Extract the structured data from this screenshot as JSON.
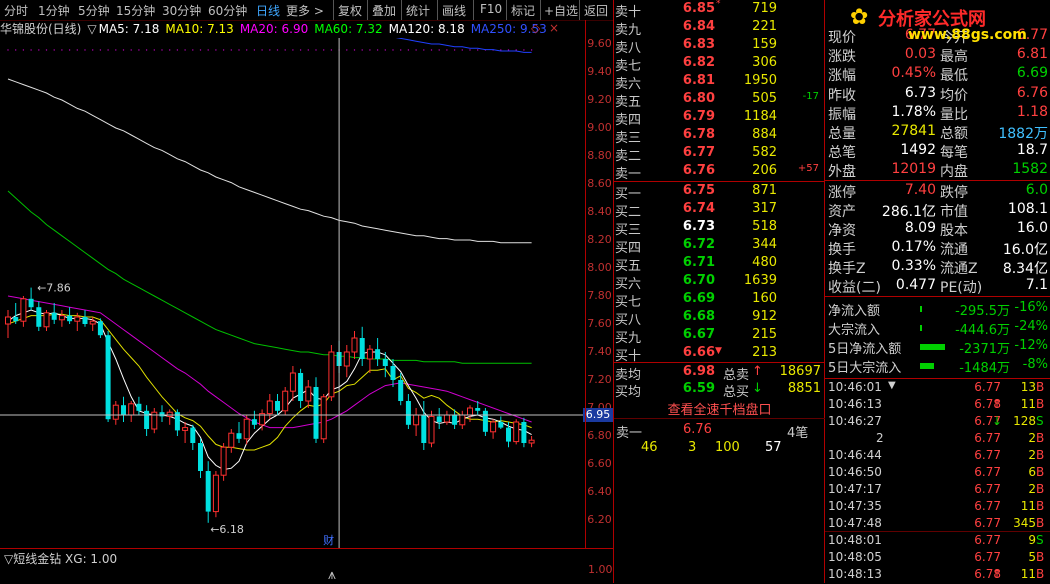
{
  "toolbar": {
    "tabs": [
      "分时",
      "1分钟",
      "5分钟",
      "15分钟",
      "30分钟",
      "60分钟",
      "日线",
      "更多 >"
    ],
    "active_tab": "日线",
    "buttons": [
      "复权",
      "叠加",
      "统计",
      "画线",
      "F10",
      "标记",
      "+自选",
      "返回"
    ]
  },
  "chart_title": {
    "stock": "华锦股份(日线)",
    "ma5": "MA5: 7.18",
    "ma10": "MA10: 7.13",
    "ma20": "MA20: 6.90",
    "ma60": "MA60: 7.32",
    "ma120": "MA120: 8.18",
    "ma250": "MA250: 9.53",
    "colors": {
      "ma5": "#ffffff",
      "ma10": "#ffff00",
      "ma20": "#ff00ff",
      "ma60": "#00ff00",
      "ma120": "#ffffff",
      "ma250": "#3050ff"
    }
  },
  "chart_data": {
    "type": "candlestick",
    "ylim": [
      6.0,
      9.8
    ],
    "yticks": [
      "9.60",
      "9.40",
      "9.20",
      "9.00",
      "8.80",
      "8.60",
      "8.40",
      "8.20",
      "8.00",
      "7.80",
      "7.60",
      "7.40",
      "7.20",
      "7.00",
      "6.80",
      "6.60",
      "6.40",
      "6.20"
    ],
    "cursor_price": "6.95",
    "high_label": "7.86",
    "low_label": "6.18",
    "marker": "财",
    "candles": [
      [
        7.6,
        7.7,
        7.5,
        7.65
      ],
      [
        7.65,
        7.75,
        7.6,
        7.62
      ],
      [
        7.62,
        7.8,
        7.58,
        7.78
      ],
      [
        7.78,
        7.86,
        7.7,
        7.72
      ],
      [
        7.72,
        7.76,
        7.55,
        7.58
      ],
      [
        7.58,
        7.7,
        7.55,
        7.68
      ],
      [
        7.68,
        7.75,
        7.6,
        7.63
      ],
      [
        7.63,
        7.7,
        7.58,
        7.66
      ],
      [
        7.66,
        7.72,
        7.6,
        7.62
      ],
      [
        7.62,
        7.68,
        7.55,
        7.65
      ],
      [
        7.65,
        7.7,
        7.58,
        7.6
      ],
      [
        7.6,
        7.65,
        7.55,
        7.62
      ],
      [
        7.62,
        7.64,
        7.5,
        7.52
      ],
      [
        7.52,
        7.55,
        6.9,
        6.92
      ],
      [
        6.92,
        7.05,
        6.88,
        7.02
      ],
      [
        7.02,
        7.08,
        6.9,
        6.95
      ],
      [
        6.95,
        7.05,
        6.9,
        7.03
      ],
      [
        7.03,
        7.08,
        6.95,
        6.98
      ],
      [
        6.98,
        7.02,
        6.8,
        6.85
      ],
      [
        6.85,
        7.0,
        6.82,
        6.97
      ],
      [
        6.97,
        7.02,
        6.9,
        6.94
      ],
      [
        6.94,
        6.99,
        6.88,
        6.97
      ],
      [
        6.97,
        6.99,
        6.8,
        6.84
      ],
      [
        6.84,
        6.9,
        6.75,
        6.86
      ],
      [
        6.86,
        6.88,
        6.7,
        6.75
      ],
      [
        6.75,
        6.78,
        6.5,
        6.55
      ],
      [
        6.55,
        6.62,
        6.18,
        6.26
      ],
      [
        6.26,
        6.55,
        6.22,
        6.52
      ],
      [
        6.52,
        6.75,
        6.48,
        6.72
      ],
      [
        6.72,
        6.85,
        6.68,
        6.82
      ],
      [
        6.82,
        6.9,
        6.75,
        6.78
      ],
      [
        6.78,
        6.95,
        6.74,
        6.92
      ],
      [
        6.92,
        6.98,
        6.85,
        6.88
      ],
      [
        6.88,
        6.99,
        6.84,
        6.96
      ],
      [
        6.96,
        7.1,
        6.92,
        7.05
      ],
      [
        7.05,
        7.1,
        6.95,
        6.98
      ],
      [
        6.98,
        7.15,
        6.95,
        7.12
      ],
      [
        7.12,
        7.3,
        7.05,
        7.25
      ],
      [
        7.25,
        7.28,
        7.0,
        7.05
      ],
      [
        7.05,
        7.2,
        7.0,
        7.15
      ],
      [
        7.15,
        7.22,
        6.75,
        6.78
      ],
      [
        6.78,
        7.1,
        6.75,
        7.08
      ],
      [
        7.08,
        7.45,
        7.05,
        7.4
      ],
      [
        7.4,
        7.48,
        7.25,
        7.3
      ],
      [
        7.3,
        7.45,
        7.22,
        7.4
      ],
      [
        7.4,
        7.55,
        7.35,
        7.5
      ],
      [
        7.5,
        7.58,
        7.3,
        7.35
      ],
      [
        7.35,
        7.45,
        7.25,
        7.42
      ],
      [
        7.42,
        7.5,
        7.3,
        7.35
      ],
      [
        7.35,
        7.4,
        7.22,
        7.3
      ],
      [
        7.3,
        7.35,
        7.15,
        7.2
      ],
      [
        7.2,
        7.25,
        7.02,
        7.05
      ],
      [
        7.05,
        7.1,
        6.85,
        6.88
      ],
      [
        6.88,
        7.0,
        6.8,
        6.95
      ],
      [
        6.95,
        7.05,
        6.7,
        6.75
      ],
      [
        6.75,
        6.98,
        6.72,
        6.94
      ],
      [
        6.94,
        7.0,
        6.85,
        6.9
      ],
      [
        6.9,
        6.98,
        6.88,
        6.95
      ],
      [
        6.95,
        6.99,
        6.85,
        6.88
      ],
      [
        6.88,
        6.98,
        6.85,
        6.95
      ],
      [
        6.95,
        7.02,
        6.9,
        7.0
      ],
      [
        7.0,
        7.05,
        6.95,
        6.98
      ],
      [
        6.98,
        7.0,
        6.8,
        6.83
      ],
      [
        6.83,
        6.92,
        6.78,
        6.9
      ],
      [
        6.9,
        6.94,
        6.85,
        6.86
      ],
      [
        6.86,
        6.9,
        6.72,
        6.76
      ],
      [
        6.76,
        6.92,
        6.74,
        6.9
      ],
      [
        6.9,
        6.93,
        6.72,
        6.75
      ],
      [
        6.75,
        6.8,
        6.72,
        6.77
      ]
    ],
    "ma5": [
      7.62,
      7.66,
      7.68,
      7.7,
      7.68,
      7.67,
      7.68,
      7.66,
      7.64,
      7.64,
      7.64,
      7.63,
      7.6,
      7.47,
      7.35,
      7.21,
      7.08,
      6.98,
      6.96,
      6.95,
      6.95,
      6.94,
      6.92,
      6.89,
      6.87,
      6.79,
      6.65,
      6.59,
      6.56,
      6.57,
      6.62,
      6.75,
      6.82,
      6.87,
      6.92,
      6.95,
      7.0,
      7.07,
      7.1,
      7.13,
      7.07,
      7.06,
      7.13,
      7.15,
      7.19,
      7.28,
      7.39,
      7.4,
      7.4,
      7.38,
      7.32,
      7.26,
      7.16,
      7.07,
      6.97,
      6.91,
      6.89,
      6.9,
      6.89,
      6.92,
      6.94,
      6.95,
      6.93,
      6.92,
      6.9,
      6.87,
      6.85,
      6.84,
      6.81
    ],
    "ma10": [
      7.6,
      7.62,
      7.64,
      7.66,
      7.66,
      7.66,
      7.67,
      7.67,
      7.66,
      7.66,
      7.65,
      7.65,
      7.63,
      7.56,
      7.49,
      7.42,
      7.36,
      7.3,
      7.22,
      7.15,
      7.08,
      7.02,
      6.96,
      6.93,
      6.91,
      6.87,
      6.8,
      6.74,
      6.72,
      6.72,
      6.71,
      6.7,
      6.7,
      6.72,
      6.74,
      6.79,
      6.87,
      6.93,
      6.98,
      7.02,
      7.01,
      7.03,
      7.1,
      7.12,
      7.16,
      7.17,
      7.22,
      7.27,
      7.27,
      7.28,
      7.2,
      7.23,
      7.14,
      7.11,
      7.07,
      7.09,
      7.07,
      7.02,
      6.98,
      6.94,
      6.92,
      6.92,
      6.91,
      6.9,
      6.91,
      6.9,
      6.89,
      6.88,
      6.86
    ],
    "ma20": [
      7.8,
      7.79,
      7.78,
      7.77,
      7.76,
      7.75,
      7.74,
      7.73,
      7.72,
      7.71,
      7.7,
      7.69,
      7.68,
      7.64,
      7.6,
      7.56,
      7.52,
      7.48,
      7.44,
      7.4,
      7.36,
      7.32,
      7.28,
      7.25,
      7.21,
      7.17,
      7.12,
      7.08,
      7.04,
      7.0,
      6.96,
      6.93,
      6.9,
      6.88,
      6.86,
      6.86,
      6.86,
      6.86,
      6.87,
      6.88,
      6.89,
      6.9,
      6.92,
      6.95,
      6.98,
      7.02,
      7.06,
      7.1,
      7.13,
      7.16,
      7.17,
      7.18,
      7.17,
      7.16,
      7.15,
      7.14,
      7.13,
      7.12,
      7.1,
      7.08,
      7.06,
      7.04,
      7.02,
      7.0,
      6.98,
      6.96,
      6.94,
      6.92,
      6.9
    ],
    "ma60": [
      8.55,
      8.5,
      8.45,
      8.4,
      8.36,
      8.31,
      8.27,
      8.23,
      8.19,
      8.15,
      8.11,
      8.07,
      8.03,
      7.99,
      7.96,
      7.92,
      7.89,
      7.86,
      7.83,
      7.8,
      7.77,
      7.74,
      7.71,
      7.68,
      7.65,
      7.62,
      7.59,
      7.56,
      7.54,
      7.52,
      7.5,
      7.48,
      7.46,
      7.45,
      7.44,
      7.43,
      7.42,
      7.41,
      7.4,
      7.4,
      7.39,
      7.38,
      7.38,
      7.37,
      7.37,
      7.36,
      7.36,
      7.35,
      7.35,
      7.35,
      7.34,
      7.34,
      7.34,
      7.34,
      7.33,
      7.33,
      7.33,
      7.33,
      7.33,
      7.32,
      7.32,
      7.32,
      7.32,
      7.32,
      7.32,
      7.32,
      7.32,
      7.32,
      7.32
    ],
    "ma120": [
      9.35,
      9.33,
      9.31,
      9.29,
      9.27,
      9.25,
      9.22,
      9.2,
      9.17,
      9.14,
      9.12,
      9.09,
      9.06,
      9.03,
      9.0,
      8.98,
      8.95,
      8.92,
      8.89,
      8.86,
      8.84,
      8.81,
      8.78,
      8.76,
      8.73,
      8.7,
      8.68,
      8.65,
      8.63,
      8.61,
      8.58,
      8.56,
      8.54,
      8.52,
      8.5,
      8.48,
      8.46,
      8.44,
      8.42,
      8.41,
      8.39,
      8.37,
      8.36,
      8.34,
      8.33,
      8.32,
      8.3,
      8.29,
      8.28,
      8.27,
      8.26,
      8.25,
      8.24,
      8.23,
      8.23,
      8.22,
      8.21,
      8.21,
      8.2,
      8.2,
      8.2,
      8.19,
      8.19,
      8.19,
      8.18,
      8.18,
      8.18,
      8.18,
      8.18
    ],
    "ma250_start": 44,
    "ma250": [
      9.71,
      9.7,
      9.69,
      9.68,
      9.67,
      9.66,
      9.65,
      9.64,
      9.63,
      9.62,
      9.61,
      9.6,
      9.6,
      9.59,
      9.58,
      9.58,
      9.57,
      9.57,
      9.56,
      9.56,
      9.55,
      9.55,
      9.55,
      9.54,
      9.54
    ]
  },
  "indicator": {
    "label": "▽短线金钻 XG: 1.00",
    "axis_value": "1.00"
  },
  "order_book": {
    "sell": [
      {
        "label": "卖十",
        "price": "6.85",
        "vol": "719",
        "chg": "",
        "mark": "*"
      },
      {
        "label": "卖九",
        "price": "6.84",
        "vol": "221",
        "chg": ""
      },
      {
        "label": "卖八",
        "price": "6.83",
        "vol": "159",
        "chg": ""
      },
      {
        "label": "卖七",
        "price": "6.82",
        "vol": "306",
        "chg": ""
      },
      {
        "label": "卖六",
        "price": "6.81",
        "vol": "1950",
        "chg": ""
      },
      {
        "label": "卖五",
        "price": "6.80",
        "vol": "505",
        "chg": "-17"
      },
      {
        "label": "卖四",
        "price": "6.79",
        "vol": "1184",
        "chg": ""
      },
      {
        "label": "卖三",
        "price": "6.78",
        "vol": "884",
        "chg": ""
      },
      {
        "label": "卖二",
        "price": "6.77",
        "vol": "582",
        "chg": ""
      },
      {
        "label": "卖一",
        "price": "6.76",
        "vol": "206",
        "chg": "+57"
      }
    ],
    "buy": [
      {
        "label": "买一",
        "price": "6.75",
        "vol": "871",
        "color": "red"
      },
      {
        "label": "买二",
        "price": "6.74",
        "vol": "317",
        "color": "red"
      },
      {
        "label": "买三",
        "price": "6.73",
        "vol": "518",
        "color": "white"
      },
      {
        "label": "买四",
        "price": "6.72",
        "vol": "344",
        "color": "green"
      },
      {
        "label": "买五",
        "price": "6.71",
        "vol": "480",
        "color": "green"
      },
      {
        "label": "买六",
        "price": "6.70",
        "vol": "1639",
        "color": "green"
      },
      {
        "label": "买七",
        "price": "6.69",
        "vol": "160",
        "color": "green"
      },
      {
        "label": "买八",
        "price": "6.68",
        "vol": "912",
        "color": "green"
      },
      {
        "label": "买九",
        "price": "6.67",
        "vol": "215",
        "color": "green"
      },
      {
        "label": "买十",
        "price": "6.66",
        "vol": "213",
        "color": "red",
        "mark": "▼"
      }
    ],
    "avg_sell": {
      "label": "卖均",
      "price": "6.98",
      "tlabel": "总卖",
      "arrow": "↑",
      "total": "18697"
    },
    "avg_buy": {
      "label": "买均",
      "price": "6.59",
      "tlabel": "总买",
      "arrow": "↓",
      "total": "8851"
    },
    "full_depth_button": "查看全速千档盘口",
    "sell1_detail": {
      "label": "卖一",
      "price": "6.76",
      "count": "4笔",
      "orders": [
        "46",
        "3",
        "100",
        "57"
      ]
    }
  },
  "stats": {
    "logo_text": "分析家公式网",
    "logo_url": "www.88gs.com",
    "rows": [
      {
        "k1": "现价",
        "v1": "6.77",
        "c1": "red",
        "k2": "今开",
        "v2": "6.77",
        "c2": "red"
      },
      {
        "k1": "涨跌",
        "v1": "0.03",
        "c1": "red",
        "k2": "最高",
        "v2": "6.81",
        "c2": "red"
      },
      {
        "k1": "涨幅",
        "v1": "0.45%",
        "c1": "red",
        "k2": "最低",
        "v2": "6.69",
        "c2": "green"
      },
      {
        "k1": "昨收",
        "v1": "6.73",
        "c1": "white",
        "k2": "均价",
        "v2": "6.76",
        "c2": "red"
      },
      {
        "k1": "振幅",
        "v1": "1.78%",
        "c1": "white",
        "k2": "量比",
        "v2": "1.18",
        "c2": "red"
      },
      {
        "k1": "总量",
        "v1": "27841",
        "c1": "yellow",
        "k2": "总额",
        "v2": "1882万",
        "c2": "cyan"
      },
      {
        "k1": "总笔",
        "v1": "1492",
        "c1": "white",
        "k2": "每笔",
        "v2": "18.7",
        "c2": "white"
      },
      {
        "k1": "外盘",
        "v1": "12019",
        "c1": "red",
        "k2": "内盘",
        "v2": "1582",
        "c2": "green"
      }
    ],
    "rows2": [
      {
        "k1": "涨停",
        "v1": "7.40",
        "c1": "red",
        "k2": "跌停",
        "v2": "6.0",
        "c2": "green"
      },
      {
        "k1": "资产",
        "v1": "286.1亿",
        "c1": "white",
        "k2": "市值",
        "v2": "108.1",
        "c2": "white"
      },
      {
        "k1": "净资",
        "v1": "8.09",
        "c1": "white",
        "k2": "股本",
        "v2": "16.0",
        "c2": "white"
      },
      {
        "k1": "换手",
        "v1": "0.17%",
        "c1": "white",
        "k2": "流通",
        "v2": "16.0亿",
        "c2": "white"
      },
      {
        "k1": "换手Z",
        "v1": "0.33%",
        "c1": "white",
        "k2": "流通Z",
        "v2": "8.34亿",
        "c2": "white"
      },
      {
        "k1": "收益(二)",
        "v1": "0.477",
        "c1": "white",
        "k2": "PE(动)",
        "v2": "7.1",
        "c2": "white"
      }
    ],
    "flows": [
      {
        "label": "净流入额",
        "amount": "-295.5万",
        "pct": "-16%",
        "bar": 0.03
      },
      {
        "label": "大宗流入",
        "amount": "-444.6万",
        "pct": "-24%",
        "bar": 0.04
      },
      {
        "label": "5日净流入额",
        "amount": "-2371万",
        "pct": "-12%",
        "bar": 0.95
      },
      {
        "label": "5日大宗流入",
        "amount": "-1484万",
        "pct": "-8%",
        "bar": 0.55
      }
    ],
    "ticks": [
      {
        "t": "10:46:01",
        "mark": "▼",
        "p": "6.77",
        "a": "",
        "v": "13",
        "bs": "B",
        "bc": "red"
      },
      {
        "t": "10:46:13",
        "p": "6.78",
        "a": "↑",
        "v": "11",
        "bs": "B",
        "bc": "red"
      },
      {
        "t": "10:46:27",
        "p": "6.77",
        "a": "↓",
        "v": "128",
        "bs": "S",
        "bc": "green"
      },
      {
        "t": "2",
        "p": "6.77",
        "a": "",
        "v": "2",
        "bs": "B",
        "bc": "red"
      },
      {
        "t": "10:46:44",
        "p": "6.77",
        "a": "",
        "v": "2",
        "bs": "B",
        "bc": "red"
      },
      {
        "t": "10:46:50",
        "p": "6.77",
        "a": "",
        "v": "6",
        "bs": "B",
        "bc": "red"
      },
      {
        "t": "10:47:17",
        "p": "6.77",
        "a": "",
        "v": "2",
        "bs": "B",
        "bc": "red"
      },
      {
        "t": "10:47:35",
        "p": "6.77",
        "a": "",
        "v": "11",
        "bs": "B",
        "bc": "red"
      },
      {
        "t": "10:47:48",
        "p": "6.77",
        "a": "",
        "v": "345",
        "bs": "B",
        "bc": "red"
      },
      {
        "t": "10:48:01",
        "p": "6.77",
        "a": "",
        "v": "9",
        "bs": "S",
        "bc": "green"
      },
      {
        "t": "10:48:05",
        "p": "6.77",
        "a": "",
        "v": "5",
        "bs": "B",
        "bc": "red"
      },
      {
        "t": "10:48:13",
        "p": "6.78",
        "a": "↑",
        "v": "11",
        "bs": "B",
        "bc": "red"
      }
    ]
  }
}
